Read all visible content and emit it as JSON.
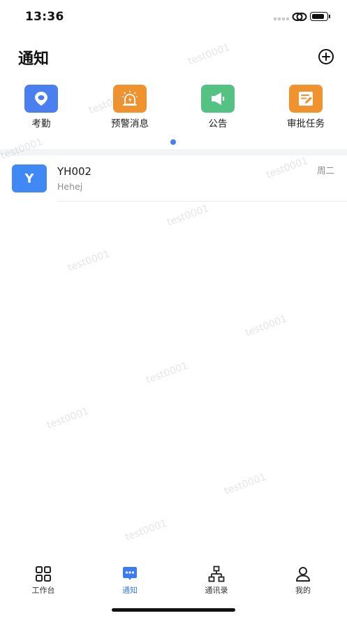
{
  "status_bar": {
    "time": "13:36",
    "battery_level": 0.85,
    "icons": [
      "signal-icon",
      "link-icon",
      "battery-icon"
    ]
  },
  "header": {
    "title": "通知",
    "add_icon": "plus-circle-icon"
  },
  "quick_actions": [
    {
      "label": "考勤",
      "icon": "location-pin-icon",
      "color": "#4a7ff0"
    },
    {
      "label": "预警消息",
      "icon": "alarm-siren-icon",
      "color": "#f0922e"
    },
    {
      "label": "公告",
      "icon": "megaphone-icon",
      "color": "#54c283"
    },
    {
      "label": "审批任务",
      "icon": "edit-document-icon",
      "color": "#f0922e"
    }
  ],
  "pager": {
    "page_count": 1,
    "active_page": 1,
    "active_color": "#4a7ff0"
  },
  "messages": [
    {
      "avatar_letter": "Y",
      "avatar_color": "#4088f3",
      "name": "YH002",
      "preview": "Hehej",
      "day": "周二"
    }
  ],
  "watermark_text": "test0001",
  "tab_bar": {
    "tabs": [
      {
        "label": "工作台",
        "icon": "grid-icon",
        "active": false
      },
      {
        "label": "通知",
        "icon": "chat-bubble-icon",
        "active": true
      },
      {
        "label": "通讯录",
        "icon": "org-chart-icon",
        "active": false
      },
      {
        "label": "我的",
        "icon": "user-icon",
        "active": false
      }
    ],
    "active_color": "#3d7cf0"
  }
}
